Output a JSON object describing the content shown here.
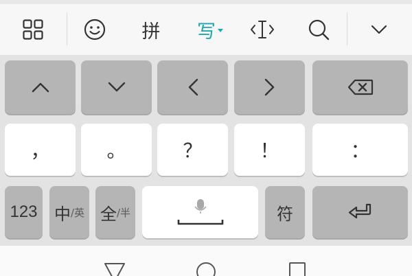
{
  "toolbar": {
    "icons": [
      "grid-icon",
      "emoji-icon",
      "cursor-icon",
      "search-icon",
      "collapse-icon"
    ],
    "pinyin_label": "拼",
    "handwrite_label": "写",
    "accent_color": "#1aa9b0"
  },
  "keyboard": {
    "row1": [
      "arrow-up-icon",
      "arrow-down-icon",
      "arrow-left-icon",
      "arrow-right-icon",
      "backspace-icon"
    ],
    "punctuation": [
      "，",
      "。",
      "？",
      "！",
      "："
    ],
    "numbers_label": "123",
    "lang_main": "中",
    "lang_sub": "/英",
    "width_main": "全",
    "width_sub": "/半",
    "symbols_label": "符"
  },
  "navbar": {
    "icons": [
      "back-icon",
      "home-icon",
      "recents-icon"
    ]
  }
}
